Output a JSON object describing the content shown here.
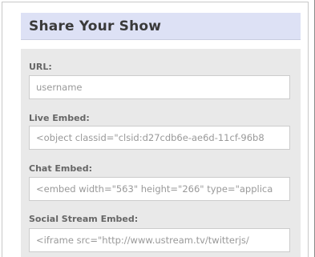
{
  "panel": {
    "title": "Share Your Show"
  },
  "fields": [
    {
      "label": "URL:",
      "value": "username"
    },
    {
      "label": "Live Embed:",
      "value": "<object classid=\"clsid:d27cdb6e-ae6d-11cf-96b8"
    },
    {
      "label": "Chat Embed:",
      "value": "<embed width=\"563\" height=\"266\" type=\"applica"
    },
    {
      "label": "Social Stream Embed:",
      "value": "<iframe src=\"http://www.ustream.tv/twitterjs/"
    }
  ]
}
